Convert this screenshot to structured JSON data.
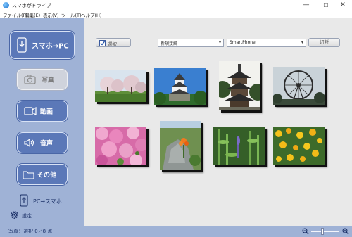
{
  "window": {
    "title": "スマホがドライブ",
    "minimize": "—",
    "maximize": "☐",
    "close": "✕"
  },
  "menu": [
    {
      "label": "ファイル(F)"
    },
    {
      "label": "編集(E)"
    },
    {
      "label": "表示(V)"
    },
    {
      "label": "ツール(T)"
    },
    {
      "label": "ヘルプ(H)"
    }
  ],
  "sidebar": {
    "phone_to_pc": "スマホ→PC",
    "photo": "写真",
    "video": "動画",
    "audio": "音声",
    "other": "その他",
    "pc_to_phone": "PC→スマホ",
    "settings": "設定"
  },
  "toolbar": {
    "select_label": "選択",
    "select_checked": true,
    "connection": {
      "value": "新規接続"
    },
    "device": {
      "value": "SmartPhone"
    },
    "disconnect_label": "切断"
  },
  "photos": [
    {
      "subject": "cherry-blossom-field"
    },
    {
      "subject": "castle"
    },
    {
      "subject": "pagoda"
    },
    {
      "subject": "ferris-wheel"
    },
    {
      "subject": "pink-azalea"
    },
    {
      "subject": "orange-lily-on-rock"
    },
    {
      "subject": "green-plants"
    },
    {
      "subject": "yellow-flowers"
    }
  ],
  "status": {
    "text": "写真：選択 0／8 点"
  },
  "zoom": {
    "level_fraction": 0.45
  },
  "colors": {
    "sidebar_bg": "#9fb2d6",
    "nav_button": "#5b78b8",
    "main_bg": "#e9e9e9"
  }
}
